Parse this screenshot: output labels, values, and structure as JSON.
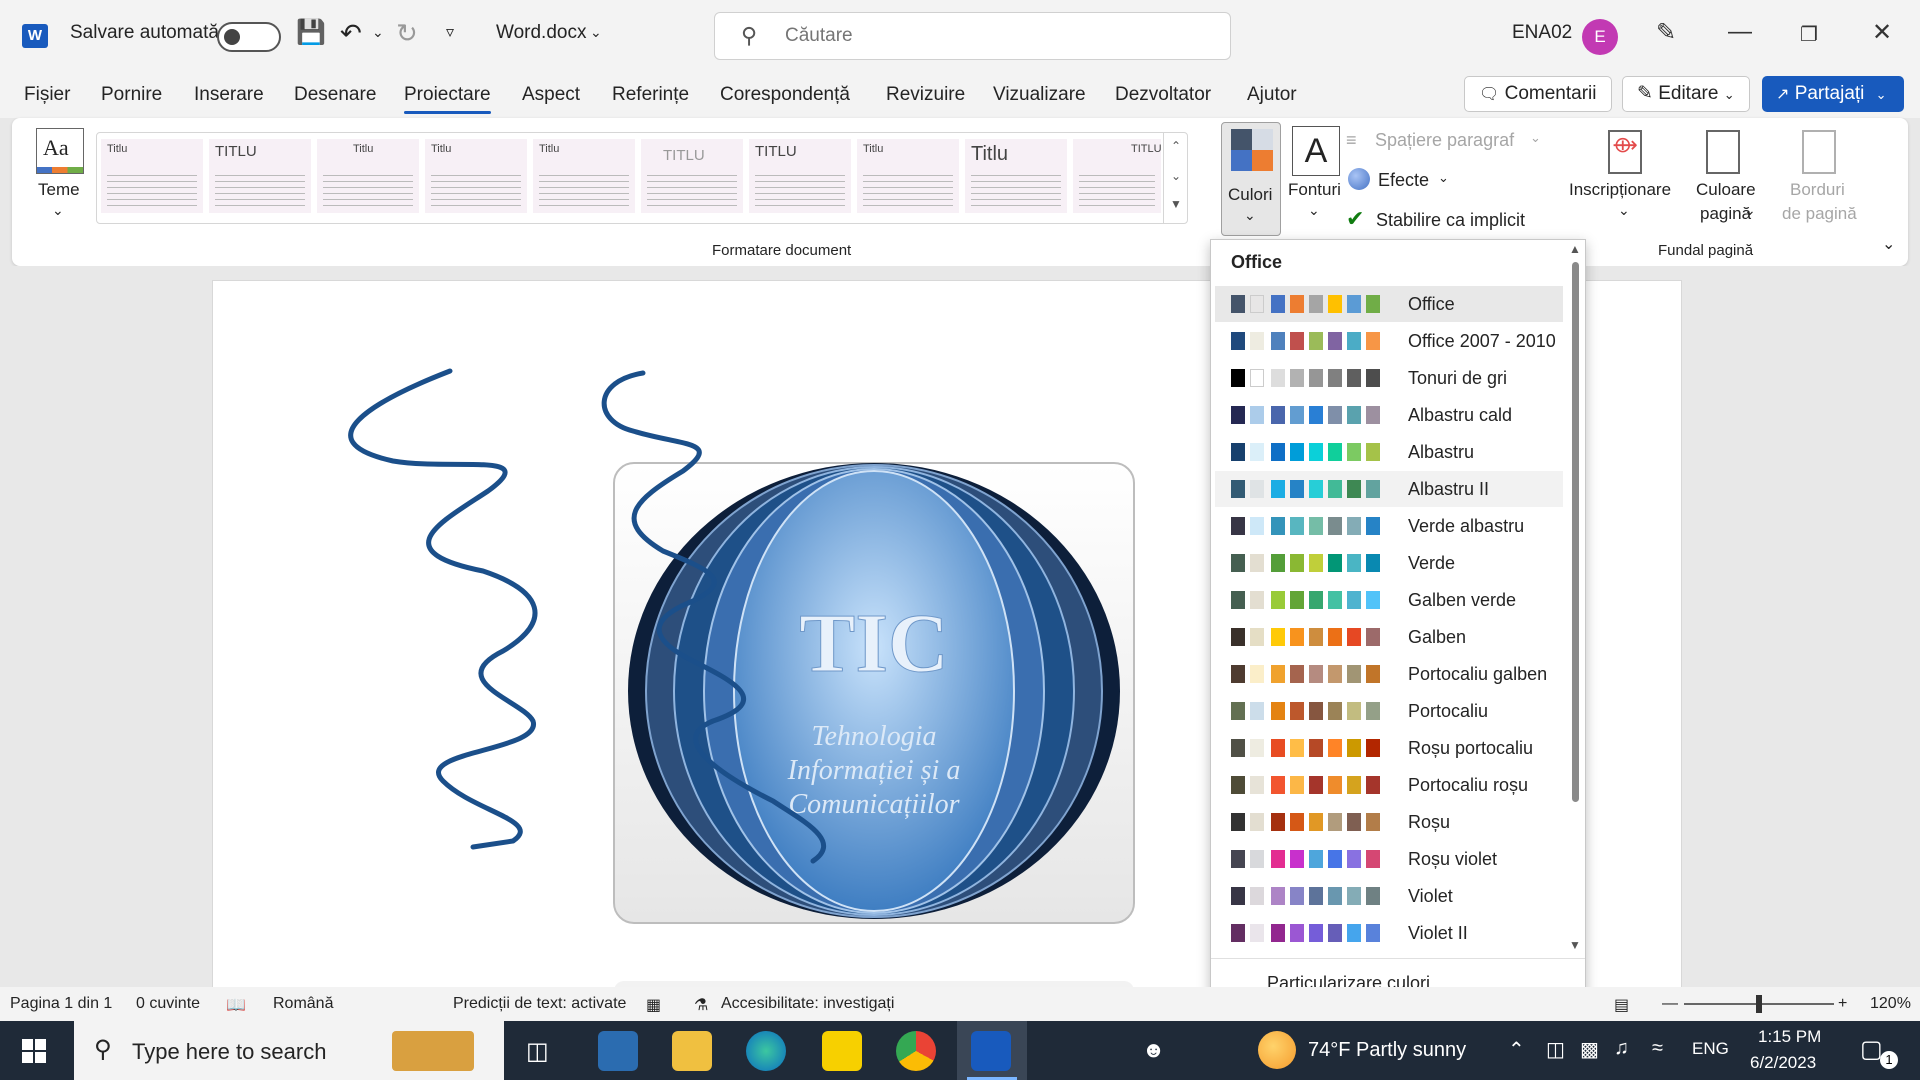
{
  "titlebar": {
    "autosave_label": "Salvare automată",
    "filename": "Word.docx",
    "search_placeholder": "Căutare",
    "user": "ENA02",
    "avatar_initial": "E"
  },
  "menu": {
    "tabs": [
      "Fișier",
      "Pornire",
      "Inserare",
      "Desenare",
      "Proiectare",
      "Aspect",
      "Referințe",
      "Corespondență",
      "Revizuire",
      "Vizualizare",
      "Dezvoltator",
      "Ajutor"
    ],
    "comments_label": "Comentarii",
    "edit_label": "Editare",
    "share_label": "Partajați"
  },
  "ribbon": {
    "themes_label": "Teme",
    "gallery_group_label": "Formatare document",
    "gallery_thumbs": [
      "Titlu",
      "TITLU",
      "Titlu",
      "Titlu",
      "Titlu",
      "TITLU",
      "TITLU",
      "Titlu",
      "Titlu",
      "TITLU"
    ],
    "colors_label": "Culori",
    "fonts_label": "Fonturi",
    "paragraph_spacing_label": "Spațiere paragraf",
    "effects_label": "Efecte",
    "set_default_label": "Stabilire ca implicit",
    "watermark_label": "Inscripționare",
    "page_color_label_1": "Culoare",
    "page_color_label_2": "pagină",
    "page_borders_label_1": "Borduri",
    "page_borders_label_2": "de pagină",
    "page_bg_group_label": "Fundal pagină"
  },
  "document": {
    "logo_title": "TIC",
    "logo_line1": "Tehnologia",
    "logo_line2": "Informației și a",
    "logo_line3": "Comunicațiilor"
  },
  "colors_dropdown": {
    "header": "Office",
    "custom_label": "Particularizare culori...",
    "items": [
      {
        "name": "Office",
        "colors": [
          "#44546a",
          "#e7e6e6",
          "#4472c4",
          "#ed7d31",
          "#a5a5a5",
          "#ffc000",
          "#5b9bd5",
          "#70ad47"
        ]
      },
      {
        "name": "Office 2007 - 2010",
        "colors": [
          "#1f497d",
          "#eeece1",
          "#4f81bd",
          "#c0504d",
          "#9bbb59",
          "#8064a2",
          "#4bacc6",
          "#f79646"
        ]
      },
      {
        "name": "Tonuri de gri",
        "colors": [
          "#000000",
          "#ffffff",
          "#dddddd",
          "#b2b2b2",
          "#969696",
          "#808080",
          "#5f5f5f",
          "#4d4d4d"
        ]
      },
      {
        "name": "Albastru cald",
        "colors": [
          "#242852",
          "#acccea",
          "#4a66ac",
          "#629dd1",
          "#297fd5",
          "#7f8fa9",
          "#5aa2ae",
          "#9d90a0"
        ]
      },
      {
        "name": "Albastru",
        "colors": [
          "#17406d",
          "#dbeff9",
          "#0f6fc6",
          "#009dd9",
          "#0bd0d9",
          "#10cf9b",
          "#7cca62",
          "#a5c249"
        ]
      },
      {
        "name": "Albastru II",
        "colors": [
          "#335b74",
          "#dfe3e5",
          "#1cade4",
          "#2683c6",
          "#27ced7",
          "#42ba97",
          "#3e8853",
          "#62a39f"
        ]
      },
      {
        "name": "Verde albastru",
        "colors": [
          "#373545",
          "#cee8f8",
          "#3494ba",
          "#58b6c0",
          "#75bda7",
          "#7a8c8e",
          "#84acb6",
          "#2683c6"
        ]
      },
      {
        "name": "Verde",
        "colors": [
          "#455f51",
          "#e3ded1",
          "#549e39",
          "#8ab833",
          "#c0cf3a",
          "#029676",
          "#4ab5c4",
          "#0989b1"
        ]
      },
      {
        "name": "Galben verde",
        "colors": [
          "#455f51",
          "#e3ded1",
          "#99cb38",
          "#63a537",
          "#37a76f",
          "#44c1a3",
          "#4eb3cf",
          "#51c3f9"
        ]
      },
      {
        "name": "Galben",
        "colors": [
          "#39302a",
          "#e5dec5",
          "#ffca08",
          "#f8931d",
          "#ce8d3e",
          "#ec7016",
          "#e64823",
          "#9c6a6a"
        ]
      },
      {
        "name": "Portocaliu galben",
        "colors": [
          "#4e3b30",
          "#fbeec9",
          "#f0a22e",
          "#a5644e",
          "#b58b80",
          "#c3986d",
          "#a19574",
          "#c17529"
        ]
      },
      {
        "name": "Portocaliu",
        "colors": [
          "#637052",
          "#ccddea",
          "#e48312",
          "#bd582c",
          "#865640",
          "#9b8357",
          "#c2bc80",
          "#94a088"
        ]
      },
      {
        "name": "Roșu portocaliu",
        "colors": [
          "#505046",
          "#eeece1",
          "#e84c22",
          "#ffbd47",
          "#b64926",
          "#ff8427",
          "#cc9900",
          "#b22600"
        ]
      },
      {
        "name": "Portocaliu roșu",
        "colors": [
          "#4e4b37",
          "#e7e3d8",
          "#f2552f",
          "#fcb747",
          "#a5352b",
          "#ef8c2c",
          "#d5a31e",
          "#a5352b"
        ]
      },
      {
        "name": "Roșu",
        "colors": [
          "#323232",
          "#e3ded1",
          "#a5300f",
          "#d55816",
          "#e19825",
          "#b19c7d",
          "#7f5f52",
          "#b27d49"
        ]
      },
      {
        "name": "Roșu violet",
        "colors": [
          "#454551",
          "#d8d9dc",
          "#e32d91",
          "#c830cc",
          "#4ea6dc",
          "#4775e7",
          "#8971e1",
          "#d54773"
        ]
      },
      {
        "name": "Violet",
        "colors": [
          "#373545",
          "#dcd8dc",
          "#ad84c6",
          "#8784c7",
          "#5d739a",
          "#6997af",
          "#84acb6",
          "#6f8183"
        ]
      },
      {
        "name": "Violet II",
        "colors": [
          "#632e62",
          "#eae5eb",
          "#92278f",
          "#9b57d3",
          "#755dd9",
          "#665eb8",
          "#45a5ed",
          "#5982db"
        ]
      }
    ]
  },
  "statusbar": {
    "page": "Pagina 1 din 1",
    "words": "0 cuvinte",
    "language": "Română",
    "predictions": "Predicții de text: activate",
    "accessibility": "Accesibilitate: investigați",
    "zoom": "120%"
  },
  "taskbar": {
    "search_placeholder": "Type here to search",
    "weather": "74°F Partly sunny",
    "lang": "ENG",
    "time": "1:15 PM",
    "date": "6/2/2023",
    "notif_count": "1"
  }
}
